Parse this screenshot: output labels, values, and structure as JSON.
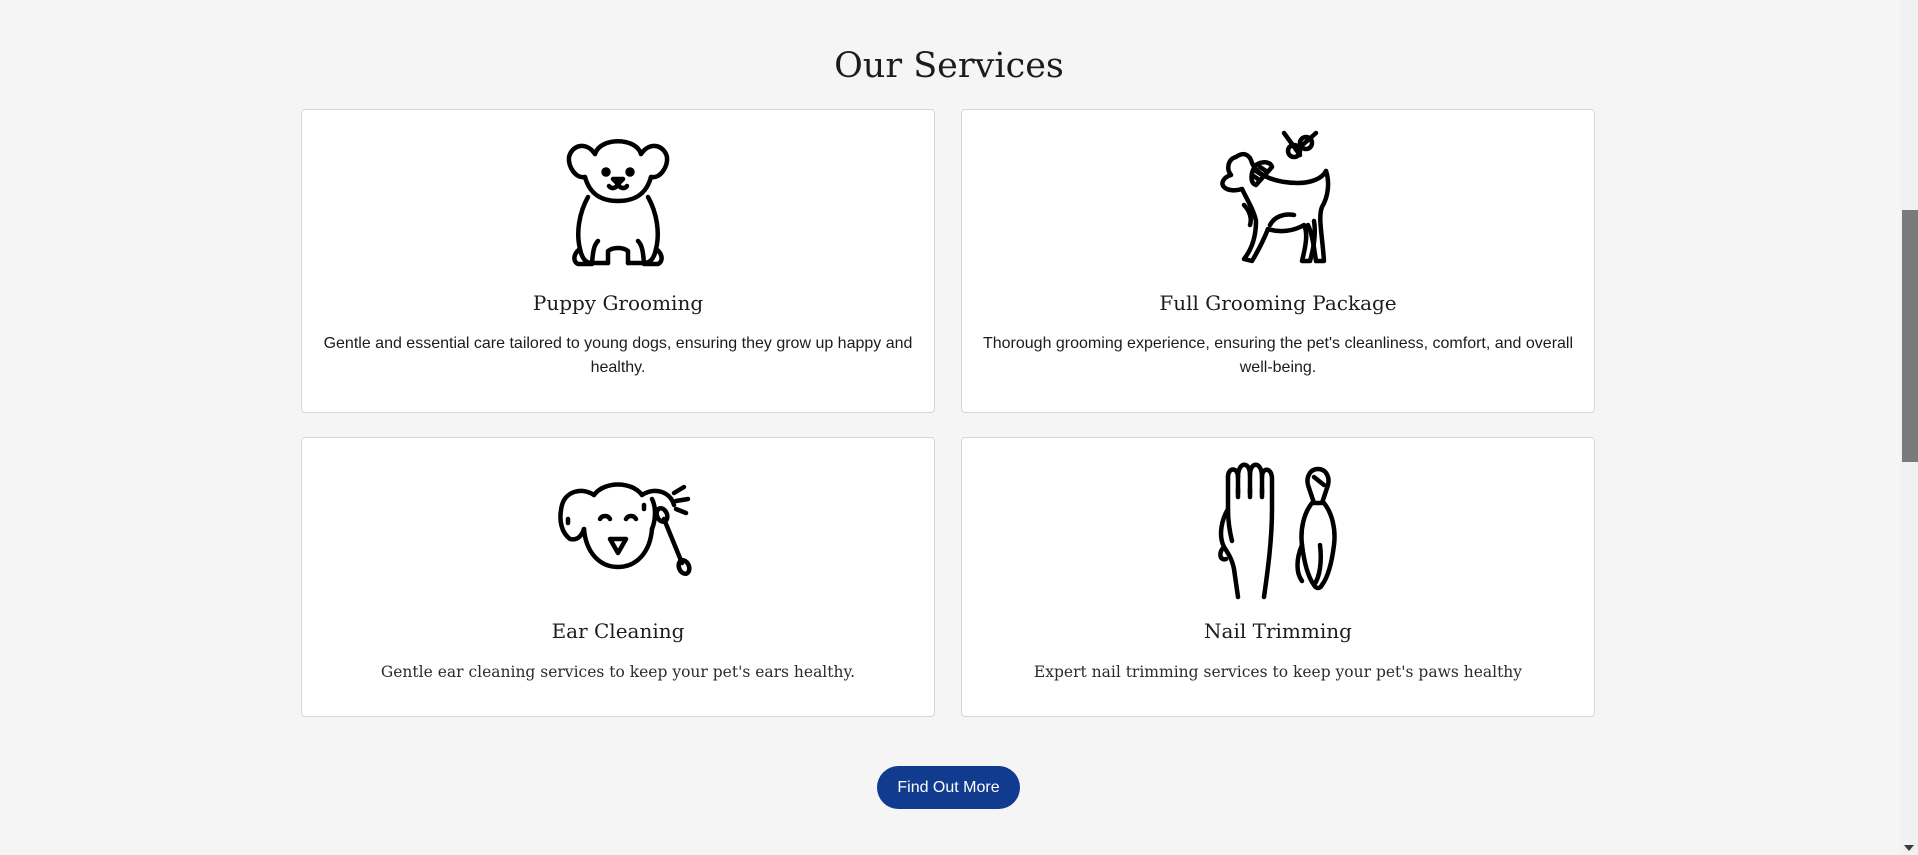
{
  "section": {
    "title": "Our Services"
  },
  "services": [
    {
      "icon": "puppy-icon",
      "title": "Puppy Grooming",
      "description": "Gentle and essential care tailored to young dogs, ensuring they grow up happy and healthy."
    },
    {
      "icon": "dog-grooming-icon",
      "title": "Full Grooming Package",
      "description": "Thorough grooming experience, ensuring the pet's cleanliness, comfort, and overall well-being."
    },
    {
      "icon": "dog-ear-cleaning-icon",
      "title": "Ear Cleaning",
      "description": "Gentle ear cleaning services to keep your pet's ears healthy."
    },
    {
      "icon": "paw-nail-clipper-icon",
      "title": "Nail Trimming",
      "description": "Expert nail trimming services to keep your pet's paws healthy"
    }
  ],
  "cta": {
    "label": "Find Out More",
    "color": "#103b8f"
  }
}
